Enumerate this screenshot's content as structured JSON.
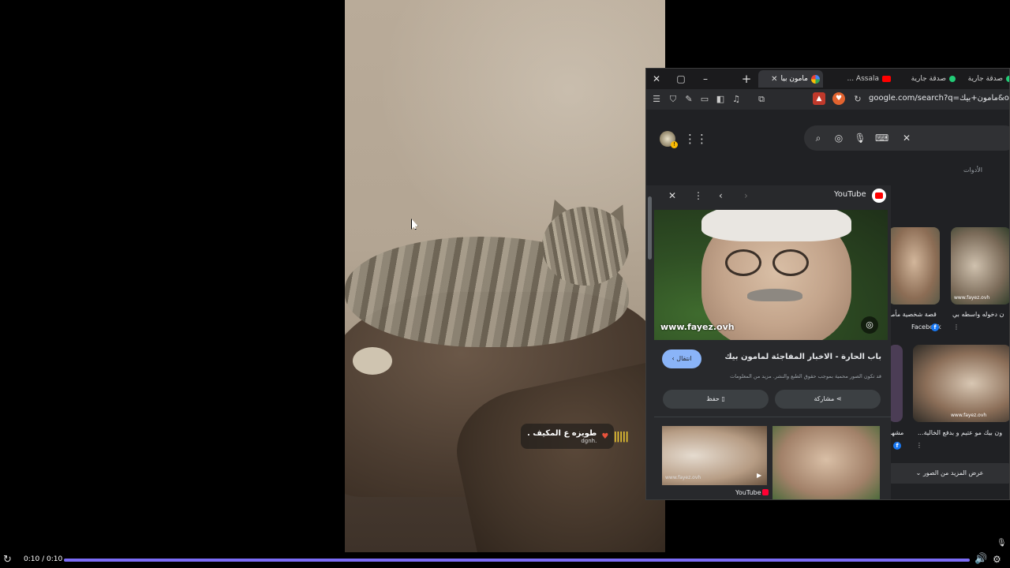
{
  "video": {
    "sticker": {
      "title": "طويزه ع المكيف .",
      "user": "dgnh."
    }
  },
  "browser": {
    "tabs": [
      {
        "label": "مامون بيا"
      },
      {
        "label": "Assala ..."
      },
      {
        "label": "صدقة جارية"
      },
      {
        "label": "صدقة جارية"
      }
    ],
    "url": "google.com/search?q=مامون+بيك&oq=مامون+بيك",
    "tools_label": "الأدوات"
  },
  "panel": {
    "source": "YouTube",
    "watermark": "www.fayez.ovh",
    "title": "باب الحارة - الاخبار المفاجئة لمامون بيك",
    "visit_label": "انتقال",
    "copyright": "قد تكون الصور محمية بموجب حقوق الطبع والنشر. مزيد من المعلومات",
    "save_label": "حفظ",
    "share_label": "مشاركة",
    "related_source": "YouTube",
    "related_watermark": "www.fayez.ovh"
  },
  "grid": {
    "captions": [
      "قصة شخصية مأمو",
      "ن دخوله واسطه بي",
      "ون بيك مو عتيم و بدفع الخالية...",
      "مشهد"
    ],
    "source_1": "Facebook",
    "watermark_1": "www.fayez.ovh",
    "watermark_2": "www.fayez.ovh",
    "more_images": "عرض المزيد من الصور"
  },
  "player": {
    "time": "0:10 / 0:10",
    "progress_fraction": 1.0,
    "accent_color": "#7b6cf6"
  }
}
